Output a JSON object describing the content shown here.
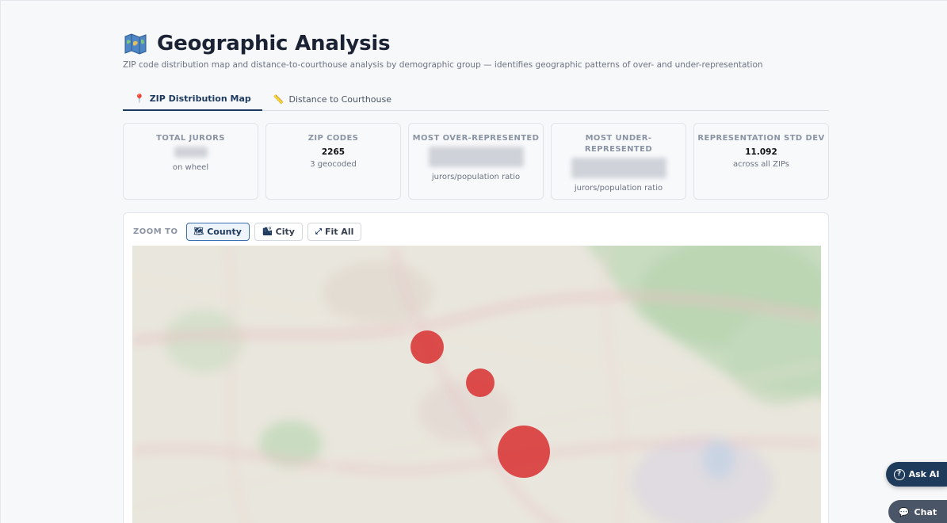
{
  "page": {
    "title": "Geographic Analysis",
    "title_icon": "map-icon",
    "subtitle": "ZIP code distribution map and distance-to-courthouse analysis by demographic group — identifies geographic patterns of over- and under-representation"
  },
  "tabs": [
    {
      "label": "ZIP Distribution Map",
      "icon": "pin-icon",
      "active": true
    },
    {
      "label": "Distance to Courthouse",
      "icon": "ruler-icon",
      "active": false
    }
  ],
  "stats": [
    {
      "label": "TOTAL JURORS",
      "value": "",
      "redacted": true,
      "sub": "on wheel"
    },
    {
      "label": "ZIP CODES",
      "value": "2265",
      "sub": "3 geocoded"
    },
    {
      "label": "MOST OVER-REPRESENTED",
      "value": "",
      "redacted": true,
      "sub": "jurors/population ratio"
    },
    {
      "label": "MOST UNDER-REPRESENTED",
      "value": "",
      "redacted": true,
      "sub": "jurors/population ratio"
    },
    {
      "label": "REPRESENTATION STD DEV",
      "value": "11.092",
      "sub": "across all ZIPs"
    }
  ],
  "map_controls": {
    "zoom_label": "ZOOM TO",
    "buttons": [
      {
        "label": "County",
        "icon": "county-icon",
        "active": true
      },
      {
        "label": "City",
        "icon": "city-icon",
        "active": false
      },
      {
        "label": "Fit All",
        "icon": "expand-icon",
        "active": false
      }
    ]
  },
  "map": {
    "marker_color": "#d93a3a",
    "markers": [
      {
        "name": "zip-marker-1"
      },
      {
        "name": "zip-marker-2"
      },
      {
        "name": "zip-marker-3"
      }
    ]
  },
  "floating": {
    "ask_ai_label": "Ask AI",
    "chat_label": "Chat"
  },
  "colors": {
    "accent": "#1e3a5f",
    "marker": "#d93a3a"
  }
}
